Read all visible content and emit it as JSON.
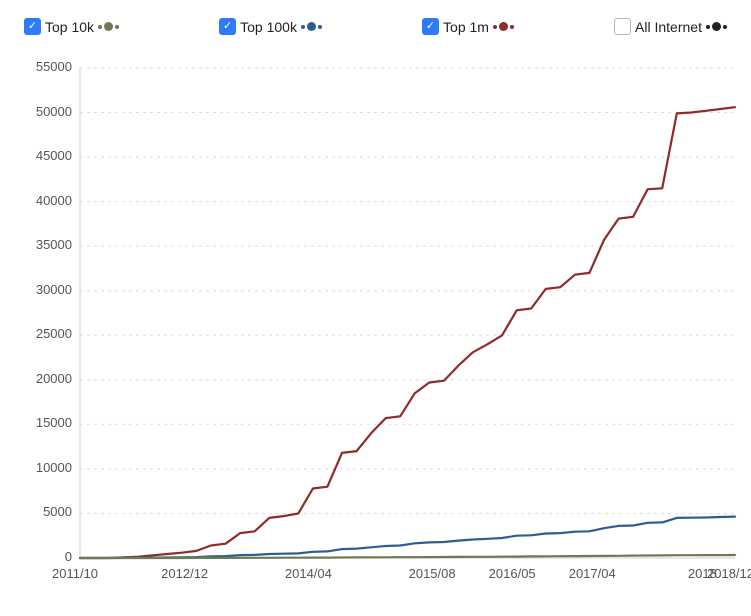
{
  "legend": {
    "items": [
      {
        "label": "Top 10k",
        "color": "#6e7a52",
        "checked": true
      },
      {
        "label": "Top 100k",
        "color": "#2f5d91",
        "checked": true
      },
      {
        "label": "Top 1m",
        "color": "#8e2b2b",
        "checked": true
      },
      {
        "label": "All Internet",
        "color": "#222222",
        "checked": false
      }
    ]
  },
  "chart_data": {
    "type": "line",
    "title": "",
    "xlabel": "",
    "ylabel": "",
    "ylim": [
      0,
      55000
    ],
    "y_ticks": [
      0,
      5000,
      10000,
      15000,
      20000,
      25000,
      30000,
      35000,
      40000,
      45000,
      50000,
      55000
    ],
    "x_tick_labels": [
      "2011/10",
      "2012/12",
      "2014/04",
      "2015/08",
      "2016/05",
      "2017/04",
      "2018/12"
    ],
    "x_extra_label": "2018",
    "x": [
      0,
      1,
      2,
      3,
      4,
      5,
      6,
      7,
      8,
      9,
      10,
      11,
      12,
      13,
      14,
      15,
      16,
      17,
      18,
      19,
      20,
      21,
      22,
      23,
      24,
      25,
      26,
      27,
      28,
      29,
      30,
      31,
      32,
      33,
      34,
      35,
      36,
      37,
      38,
      39,
      40,
      41,
      42,
      43,
      44,
      45
    ],
    "x_tick_positions": [
      0,
      7.5,
      16,
      24.5,
      30,
      35.5,
      45
    ],
    "series": [
      {
        "name": "Top 1m",
        "color": "#8e2b2b",
        "values": [
          0,
          0,
          0,
          80,
          150,
          300,
          450,
          600,
          800,
          1400,
          1600,
          2800,
          3000,
          4500,
          4700,
          5000,
          7800,
          8000,
          11800,
          12000,
          14000,
          15700,
          15900,
          18500,
          19700,
          19900,
          21600,
          23100,
          24000,
          25000,
          27800,
          28000,
          30200,
          30400,
          31800,
          32000,
          35700,
          38100,
          38300,
          41400,
          41500,
          49900,
          50000,
          50200,
          50400,
          50600
        ]
      },
      {
        "name": "Top 100k",
        "color": "#2f5d91",
        "values": [
          0,
          0,
          0,
          10,
          20,
          40,
          60,
          80,
          100,
          180,
          210,
          320,
          350,
          450,
          480,
          520,
          700,
          740,
          1000,
          1060,
          1200,
          1350,
          1400,
          1650,
          1750,
          1800,
          1950,
          2080,
          2150,
          2250,
          2500,
          2550,
          2750,
          2800,
          2950,
          3000,
          3350,
          3600,
          3650,
          3950,
          4000,
          4500,
          4520,
          4550,
          4600,
          4650
        ]
      },
      {
        "name": "Top 10k",
        "color": "#6e7a52",
        "values": [
          0,
          0,
          0,
          0,
          0,
          0,
          0,
          5,
          8,
          10,
          14,
          18,
          22,
          28,
          32,
          36,
          42,
          48,
          55,
          62,
          70,
          78,
          86,
          95,
          104,
          112,
          120,
          130,
          140,
          150,
          162,
          174,
          186,
          198,
          210,
          222,
          236,
          250,
          264,
          278,
          292,
          310,
          316,
          322,
          328,
          335
        ]
      }
    ]
  }
}
